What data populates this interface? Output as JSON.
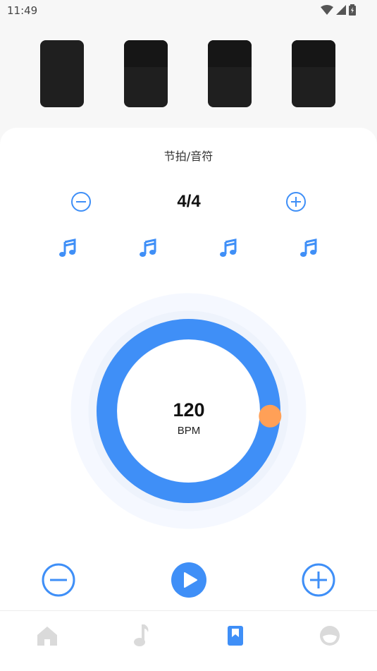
{
  "status_bar": {
    "time": "11:49"
  },
  "beat_pads": [
    {
      "state": "accent"
    },
    {
      "state": "normal"
    },
    {
      "state": "normal"
    },
    {
      "state": "normal"
    }
  ],
  "meter": {
    "title": "节拍/音符",
    "time_signature": "4/4",
    "notes": [
      "music-note-icon",
      "music-note-icon",
      "music-note-icon",
      "music-note-icon"
    ]
  },
  "tempo": {
    "value": "120",
    "unit": "BPM",
    "knob_fraction": 0.26
  },
  "colors": {
    "accent": "#3f8ff7",
    "knob": "#ffa057",
    "pad": "#1f1f1f",
    "nav_inactive": "#dadada"
  },
  "bottom_nav": [
    {
      "icon": "home-icon",
      "active": false
    },
    {
      "icon": "music-note-icon",
      "active": false
    },
    {
      "icon": "bookmark-icon",
      "active": true
    },
    {
      "icon": "profile-icon",
      "active": false
    }
  ]
}
